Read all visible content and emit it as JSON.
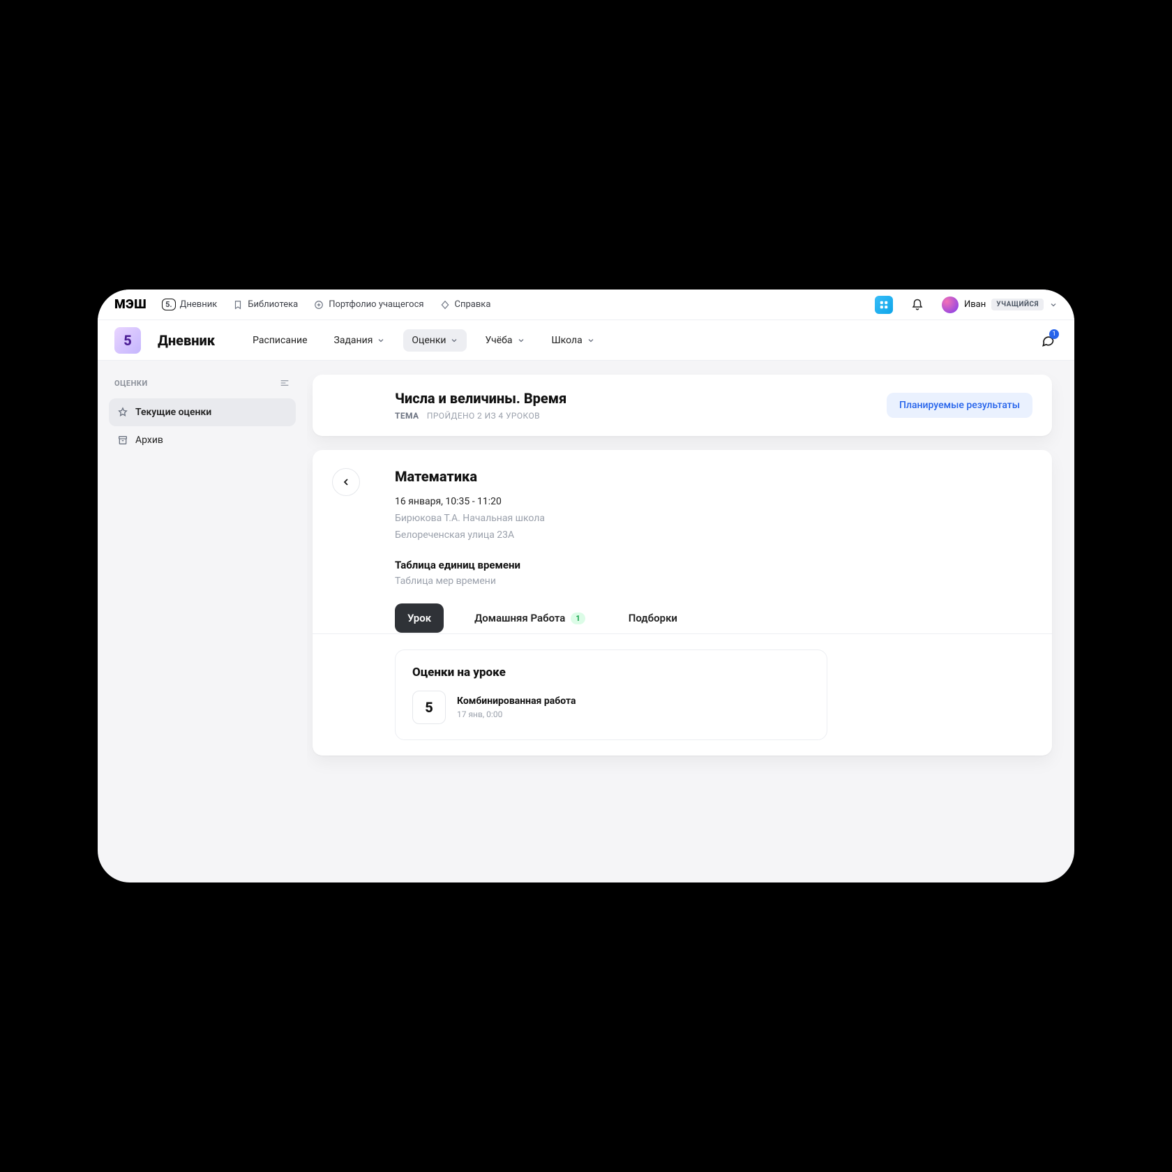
{
  "topbar": {
    "logo": "МЭШ",
    "items": [
      {
        "label": "Дневник",
        "icon": "badge-5"
      },
      {
        "label": "Библиотека",
        "icon": "bookmark"
      },
      {
        "label": "Портфолио учащегося",
        "icon": "plus-circle"
      },
      {
        "label": "Справка",
        "icon": "diamond"
      }
    ],
    "user": {
      "name": "Иван",
      "role": "УЧАЩИЙСЯ"
    }
  },
  "nav2": {
    "app_badge": "5",
    "app_title": "Дневник",
    "items": [
      {
        "label": "Расписание",
        "dropdown": false
      },
      {
        "label": "Задания",
        "dropdown": true
      },
      {
        "label": "Оценки",
        "dropdown": true,
        "active": true
      },
      {
        "label": "Учёба",
        "dropdown": true
      },
      {
        "label": "Школа",
        "dropdown": true
      }
    ],
    "chat_badge": "1"
  },
  "sidebar": {
    "heading": "ОЦЕНКИ",
    "items": [
      {
        "label": "Текущие оценки",
        "icon": "star",
        "active": true
      },
      {
        "label": "Архив",
        "icon": "archive",
        "active": false
      }
    ]
  },
  "topic": {
    "title": "Числа и величины. Время",
    "sub_label": "ТЕМА",
    "sub_text": "ПРОЙДЕНО 2 ИЗ 4 УРОКОВ",
    "plan_button": "Планируемые результаты"
  },
  "lesson": {
    "subject": "Математика",
    "datetime": "16 января, 10:35 - 11:20",
    "teacher": "Бирюкова Т.А. Начальная школа",
    "address": "Белореченская улица 23А",
    "theme_title": "Таблица единиц времени",
    "theme_sub": "Таблица мер времени",
    "tabs": [
      {
        "label": "Урок",
        "active": true
      },
      {
        "label": "Домашняя Работа",
        "badge": "1"
      },
      {
        "label": "Подборки"
      }
    ],
    "grades_section_title": "Оценки на уроке",
    "grades": [
      {
        "value": "5",
        "title": "Комбинированная работа",
        "sub": "17 янв, 0:00"
      }
    ]
  }
}
